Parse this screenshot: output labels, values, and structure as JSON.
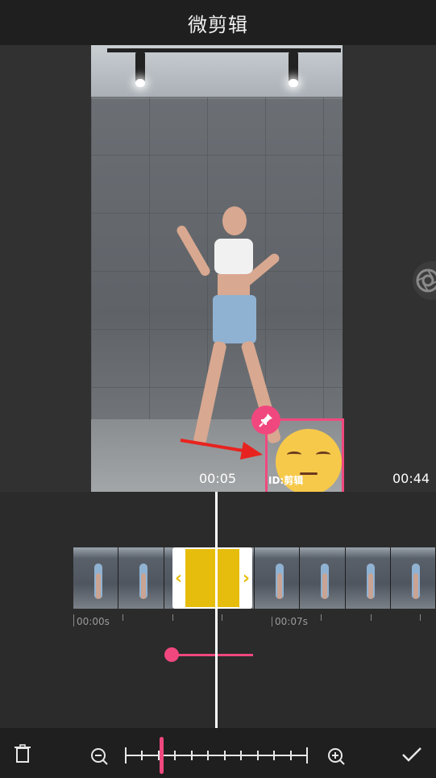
{
  "app": {
    "title": "微剪辑"
  },
  "preview": {
    "current_time": "00:05",
    "total_time": "00:44",
    "watermark": "ID:剪辑"
  },
  "timeline": {
    "labels": [
      "00:00s",
      "00:07s"
    ],
    "thumb_count": 8
  },
  "zoom": {
    "level_fraction": 0.2,
    "tick_count": 12
  },
  "colors": {
    "accent": "#f0487e",
    "selection": "#e6bd0c",
    "background": "#2b2b2b"
  },
  "icons": {
    "delete": "trash-icon",
    "zoom_out": "zoom-out-icon",
    "zoom_in": "zoom-in-icon",
    "confirm": "check-icon",
    "pin": "pin-icon",
    "camera": "camera-aperture-icon"
  }
}
